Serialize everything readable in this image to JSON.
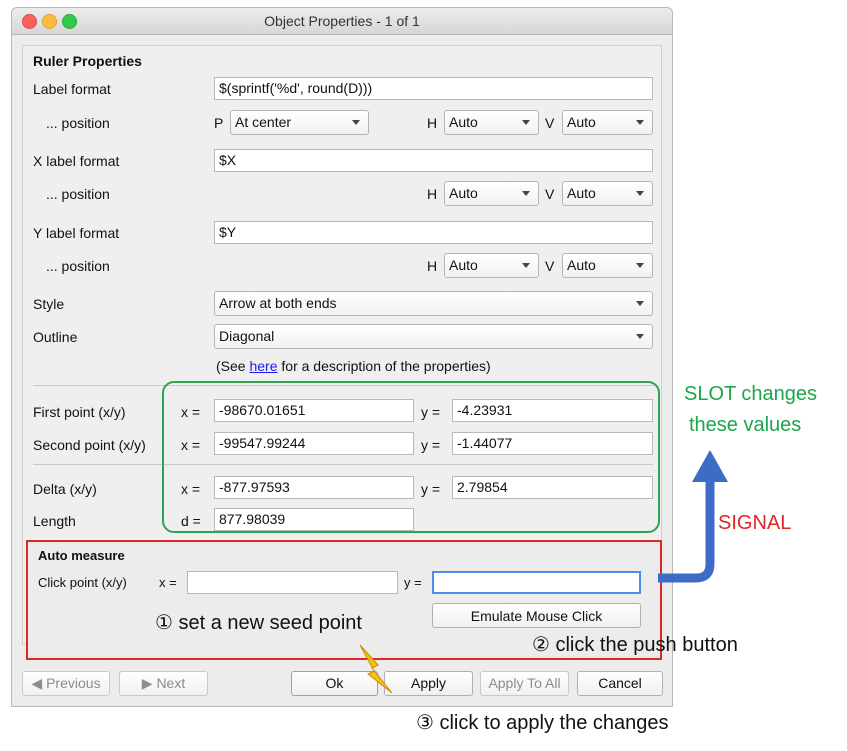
{
  "window": {
    "title": "Object Properties - 1 of 1"
  },
  "ruler": {
    "section_title": "Ruler Properties",
    "label_format_label": "Label format",
    "label_format_value": "$(sprintf('%d', round(D)))",
    "position_label": "... position",
    "p_letter": "P",
    "p_value": "At center",
    "h_letter": "H",
    "v_letter": "V",
    "label_h": "Auto",
    "label_v": "Auto",
    "x_label_format_label": "X label format",
    "x_label_format_value": "$X",
    "x_h": "Auto",
    "x_v": "Auto",
    "y_label_format_label": "Y label format",
    "y_label_format_value": "$Y",
    "y_h": "Auto",
    "y_v": "Auto",
    "style_label": "Style",
    "style_value": "Arrow at both ends",
    "outline_label": "Outline",
    "outline_value": "Diagonal",
    "see_prefix": "(See ",
    "see_link": "here",
    "see_suffix": " for a description of the properties)"
  },
  "points": {
    "first_label": "First point (x/y)",
    "second_label": "Second point (x/y)",
    "delta_label": "Delta (x/y)",
    "length_label": "Length",
    "x_eq": "x =",
    "y_eq": "y =",
    "d_eq": "d =",
    "first_x": "-98670.01651",
    "first_y": "-4.23931",
    "second_x": "-99547.99244",
    "second_y": "-1.44077",
    "delta_x": "-877.97593",
    "delta_y": "2.79854",
    "length_d": "877.98039"
  },
  "auto_measure": {
    "title": "Auto measure",
    "click_point_label": "Click point (x/y)",
    "x_eq": "x =",
    "y_eq": "y =",
    "x_value": "",
    "y_value": "",
    "emulate_button": "Emulate Mouse Click"
  },
  "buttons": {
    "previous": "Previous",
    "next": "Next",
    "ok": "Ok",
    "apply": "Apply",
    "apply_to_all": "Apply To All",
    "cancel": "Cancel"
  },
  "annotations": {
    "slot_line1": "SLOT  changes",
    "slot_line2": "these values",
    "signal": "SIGNAL",
    "step1": "① set a new seed point",
    "step2": "② click the push button",
    "step3": "③ click to apply the changes"
  },
  "colors": {
    "slot_green": "#1aa64a",
    "signal_red": "#e0262b",
    "arrow_blue": "#3d6cc6",
    "bolt_yellow": "#f5c21a"
  }
}
